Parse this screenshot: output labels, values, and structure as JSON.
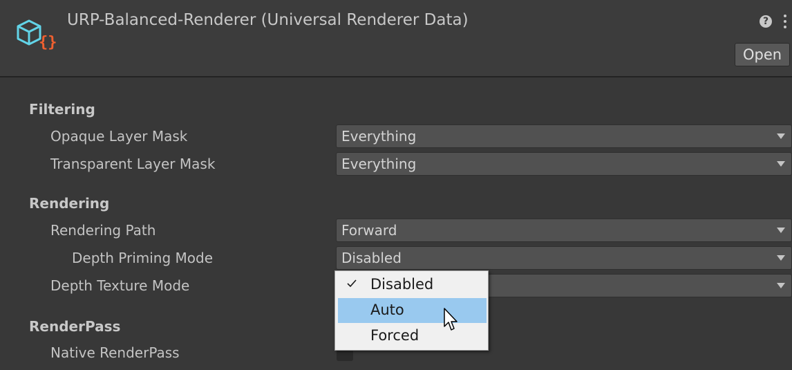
{
  "header": {
    "title": "URP-Balanced-Renderer (Universal Renderer Data)",
    "help": "?",
    "open_label": "Open"
  },
  "sections": {
    "filtering": "Filtering",
    "rendering": "Rendering",
    "renderpass": "RenderPass"
  },
  "fields": {
    "opaque_label": "Opaque Layer Mask",
    "opaque_value": "Everything",
    "transparent_label": "Transparent Layer Mask",
    "transparent_value": "Everything",
    "rendering_path_label": "Rendering Path",
    "rendering_path_value": "Forward",
    "depth_priming_label": "Depth Priming Mode",
    "depth_priming_value": "Disabled",
    "depth_texture_label": "Depth Texture Mode",
    "native_renderpass_label": "Native RenderPass"
  },
  "popup_menu": {
    "items": [
      "Disabled",
      "Auto",
      "Forced"
    ],
    "checked": "Disabled",
    "highlighted": "Auto"
  },
  "colors": {
    "background": "#383838",
    "menu_highlight": "#99c9ef",
    "icon_cyan": "#62d4e8",
    "icon_orange": "#f06030"
  }
}
